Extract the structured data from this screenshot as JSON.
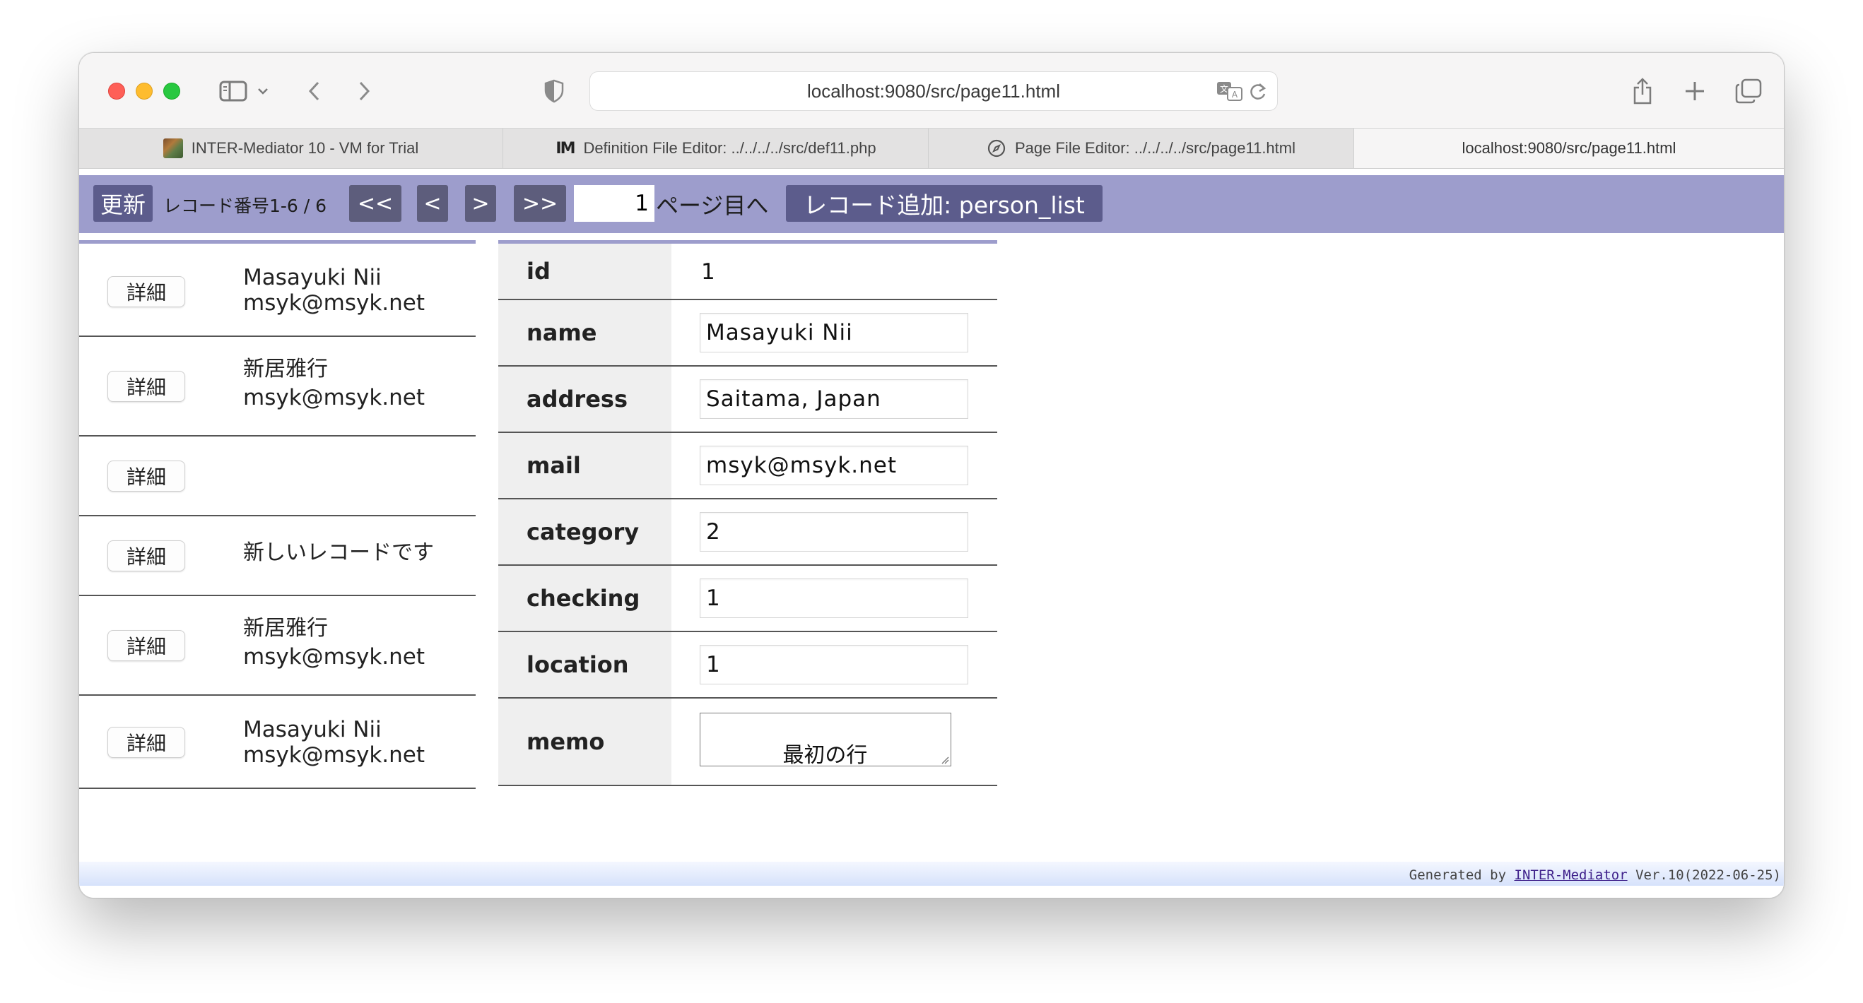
{
  "browser": {
    "url": "localhost:9080/src/page11.html",
    "tabs": [
      {
        "label": "INTER-Mediator 10 - VM for Trial",
        "favicon": "photo-favicon"
      },
      {
        "label": "Definition File Editor: ../../../../src/def11.php",
        "favicon": "im-logo-favicon"
      },
      {
        "label": "Page File Editor: ../../../../src/page11.html",
        "favicon": "compass-icon"
      },
      {
        "label": "localhost:9080/src/page11.html",
        "favicon": ""
      }
    ]
  },
  "navbar": {
    "refresh_label": "更新",
    "record_info": "レコード番号1-6 / 6",
    "first_label": "<<",
    "prev_label": "<",
    "next_label": ">",
    "last_label": ">>",
    "page_value": "1",
    "page_suffix": "ページ目へ",
    "add_record_label": "レコード追加: person_list",
    "color": "#9d9dcc"
  },
  "list": {
    "detail_label": "詳細",
    "rows": [
      {
        "name": "Masayuki Nii",
        "mail": "msyk@msyk.net"
      },
      {
        "name": "新居雅行",
        "mail": "msyk@msyk.net"
      },
      {
        "name": "",
        "mail": ""
      },
      {
        "name": "新しいレコードです",
        "mail": ""
      },
      {
        "name": "新居雅行",
        "mail": "msyk@msyk.net"
      },
      {
        "name": "Masayuki Nii",
        "mail": "msyk@msyk.net"
      }
    ]
  },
  "detail": {
    "id": {
      "label": "id",
      "value": "1"
    },
    "name": {
      "label": "name",
      "value": "Masayuki Nii"
    },
    "address": {
      "label": "address",
      "value": "Saitama, Japan"
    },
    "mail": {
      "label": "mail",
      "value": "msyk@msyk.net"
    },
    "category": {
      "label": "category",
      "value": "2"
    },
    "checking": {
      "label": "checking",
      "value": "1"
    },
    "location": {
      "label": "location",
      "value": "1"
    },
    "memo": {
      "label": "memo",
      "value": "最初の行\n改行したよ"
    }
  },
  "footer": {
    "prefix": "Generated by ",
    "link": "INTER-Mediator",
    "suffix": " Ver.10(2022-06-25)"
  }
}
